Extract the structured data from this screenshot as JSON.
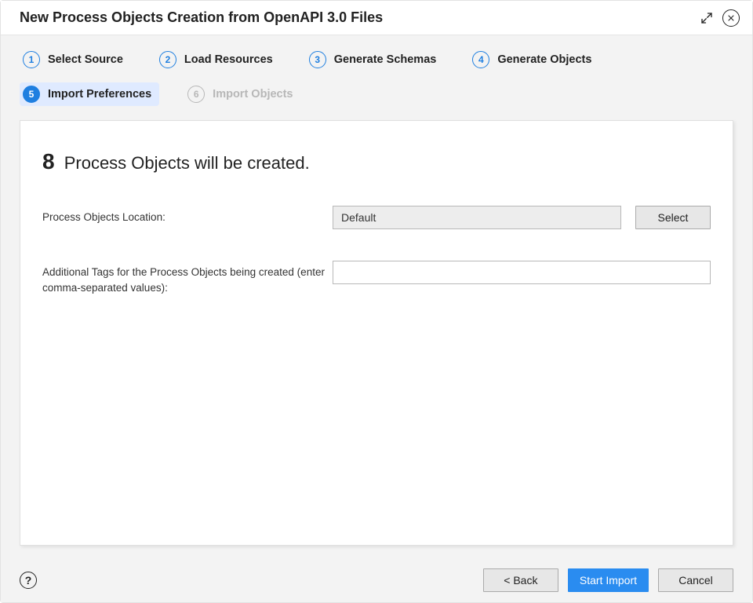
{
  "dialog": {
    "title": "New Process Objects Creation from OpenAPI 3.0 Files"
  },
  "steps": [
    {
      "num": "1",
      "label": "Select Source",
      "state": "done"
    },
    {
      "num": "2",
      "label": "Load Resources",
      "state": "done"
    },
    {
      "num": "3",
      "label": "Generate Schemas",
      "state": "done"
    },
    {
      "num": "4",
      "label": "Generate Objects",
      "state": "done"
    },
    {
      "num": "5",
      "label": "Import Preferences",
      "state": "current"
    },
    {
      "num": "6",
      "label": "Import Objects",
      "state": "disabled"
    }
  ],
  "content": {
    "count": "8",
    "headline_suffix": "Process Objects will be created.",
    "location_label": "Process Objects Location:",
    "location_value": "Default",
    "select_button": "Select",
    "tags_label": "Additional Tags for the Process Objects being created (enter comma-separated values):",
    "tags_value": ""
  },
  "footer": {
    "help": "?",
    "back": "< Back",
    "start": "Start Import",
    "cancel": "Cancel"
  }
}
